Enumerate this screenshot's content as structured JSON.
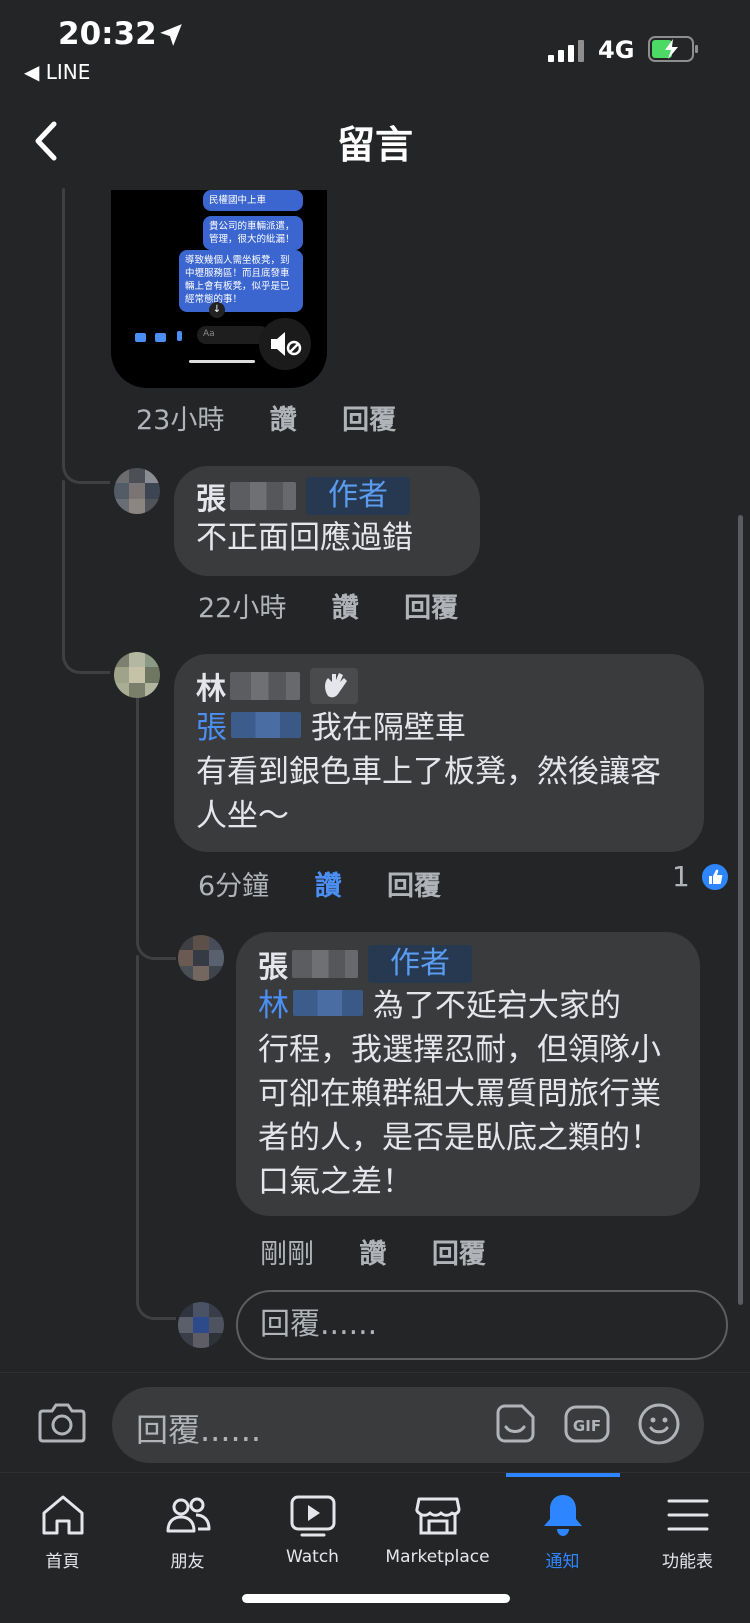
{
  "status_bar": {
    "time": "20:32",
    "back_app": "◀ LINE",
    "network": "4G"
  },
  "header": {
    "title": "留言"
  },
  "media_comment": {
    "preview_lines": [
      "民權國中上車",
      "貴公司的車輛派遣，管理，很大的紕漏！",
      "導致幾個人需坐板凳，到中壢服務區！而且底發車輛上會有板凳，似乎是已經常態的事！"
    ],
    "input_hint": "Aa",
    "time": "23小時",
    "like": "讚",
    "reply": "回覆"
  },
  "comments": [
    {
      "name": "張",
      "badge": "作者",
      "text": "不正面回應過錯",
      "time": "22小時",
      "like": "讚",
      "reply": "回覆"
    },
    {
      "name": "林",
      "mention": "張",
      "text_line1": "我在隔壁車",
      "text_rest": "有看到銀色車上了板凳，然後讓客人坐～",
      "time": "6分鐘",
      "like": "讚",
      "reply": "回覆",
      "like_count": "1"
    },
    {
      "name": "張",
      "badge": "作者",
      "mention": "林",
      "text_line1": "為了不延宕大家的",
      "text_rest": "行程，我選擇忍耐，但領隊小可卻在賴群組大罵質問旅行業者的人，是否是臥底之類的！口氣之差！",
      "time": "剛剛",
      "like": "讚",
      "reply": "回覆"
    }
  ],
  "inline_reply": {
    "placeholder": "回覆......"
  },
  "composer": {
    "placeholder": "回覆......"
  },
  "tabs": [
    {
      "label": "首頁",
      "icon": "home-icon"
    },
    {
      "label": "朋友",
      "icon": "friends-icon"
    },
    {
      "label": "Watch",
      "icon": "watch-icon"
    },
    {
      "label": "Marketplace",
      "icon": "marketplace-icon"
    },
    {
      "label": "通知",
      "icon": "bell-icon",
      "active": true
    },
    {
      "label": "功能表",
      "icon": "menu-icon"
    }
  ],
  "colors": {
    "accent": "#2d86ff",
    "mention": "#4b8ff5",
    "bubble": "#3a3b3c",
    "background": "#242526"
  }
}
